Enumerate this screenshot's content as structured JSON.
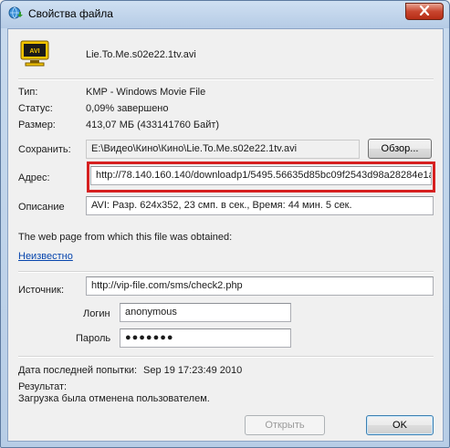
{
  "window": {
    "title": "Свойства файла"
  },
  "file": {
    "name": "Lie.To.Me.s02e22.1tv.avi",
    "icon_label": "AVI"
  },
  "info": {
    "type_label": "Тип:",
    "type_value": "KMP - Windows Movie File",
    "status_label": "Статус:",
    "status_value": "0,09% завершено",
    "size_label": "Размер:",
    "size_value": "413,07 МБ (433141760 Байт)"
  },
  "save": {
    "label": "Сохранить:",
    "path": "E:\\Видео\\Кино\\Кино\\Lie.To.Me.s02e22.1tv.avi",
    "browse_label": "Обзор..."
  },
  "address": {
    "label": "Адрес:",
    "value": "http://78.140.160.140/downloadp1/5495.56635d85bc09f2543d98a28284e1a"
  },
  "description": {
    "label": "Описание",
    "value": "AVI: Разр. 624x352, 23 смп. в сек., Время: 44 мин. 5 сек."
  },
  "webpage": {
    "caption": "The web page from which this file was obtained:",
    "link": "Неизвестно"
  },
  "source": {
    "label": "Источник:",
    "value": "http://vip-file.com/sms/check2.php"
  },
  "login": {
    "label": "Логин",
    "value": "anonymous"
  },
  "password": {
    "label": "Пароль",
    "value": "●●●●●●●"
  },
  "last_attempt": {
    "label": "Дата последней попытки:",
    "value": "Sep 19 17:23:49 2010"
  },
  "result": {
    "label": "Результат:",
    "value": "Загрузка была отменена пользователем."
  },
  "buttons": {
    "open_label": "Открыть",
    "ok_label": "OK"
  },
  "colors": {
    "highlight": "#d62020",
    "link": "#0645ad"
  }
}
